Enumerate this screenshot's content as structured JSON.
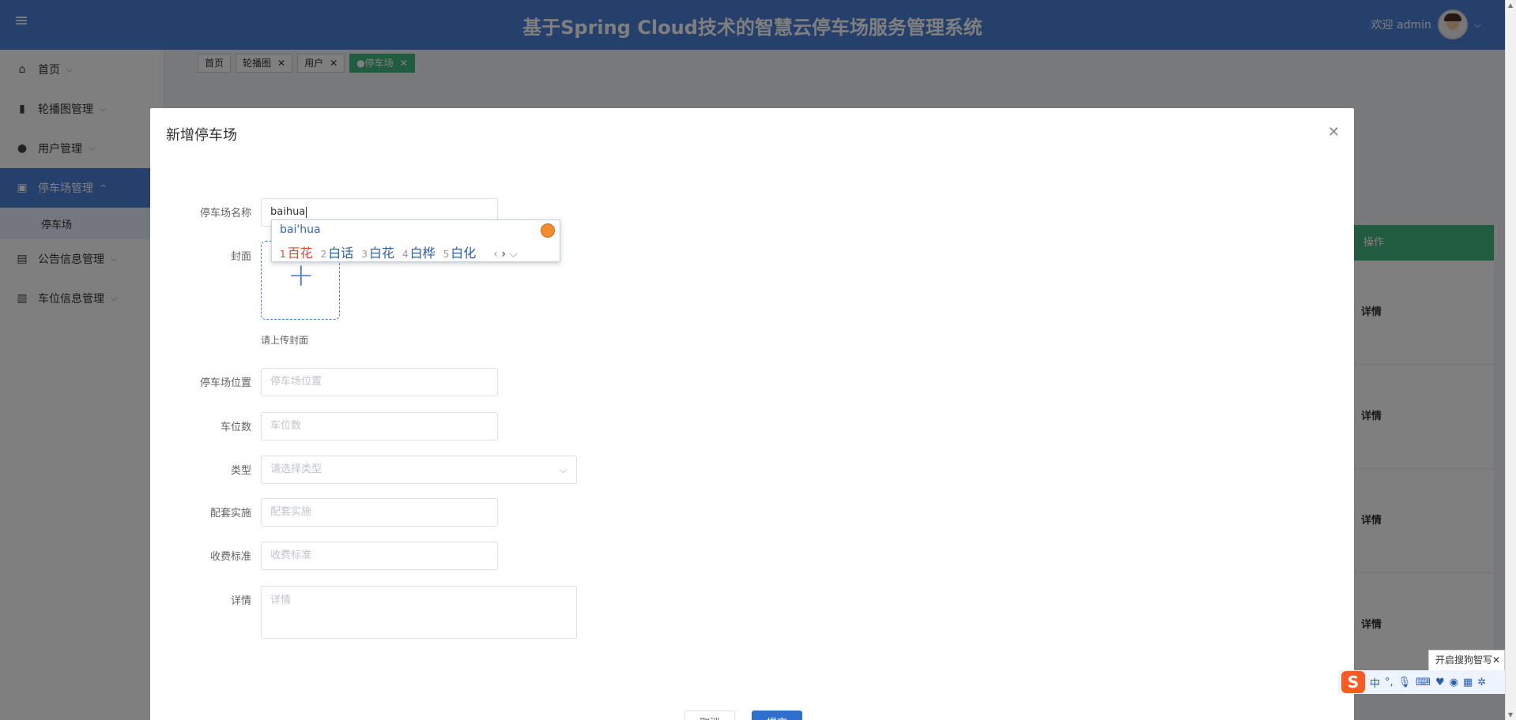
{
  "header": {
    "title": "基于Spring Cloud技术的智慧云停车场服务管理系统",
    "welcome": "欢迎 admin"
  },
  "sidebar": {
    "items": [
      {
        "label": "首页",
        "icon": "home-icon"
      },
      {
        "label": "轮播图管理",
        "icon": "book-icon"
      },
      {
        "label": "用户管理",
        "icon": "user-icon"
      },
      {
        "label": "停车场管理",
        "icon": "gift-icon"
      },
      {
        "sub": "停车场"
      },
      {
        "label": "公告信息管理",
        "icon": "briefcase-icon"
      },
      {
        "label": "车位信息管理",
        "icon": "chart-icon"
      }
    ]
  },
  "tabs": [
    {
      "label": "首页"
    },
    {
      "label": "轮播图"
    },
    {
      "label": "用户"
    },
    {
      "label": "●停车场"
    }
  ],
  "background_table": {
    "header": "操作",
    "rows": [
      "详情",
      "详情",
      "详情",
      "详情"
    ]
  },
  "dialog": {
    "title": "新增停车场",
    "fields": {
      "name_label": "停车场名称",
      "name_value": "baihua",
      "cover_label": "封面",
      "cover_tip": "请上传封面",
      "location_label": "停车场位置",
      "location_placeholder": "停车场位置",
      "spaces_label": "车位数",
      "spaces_placeholder": "车位数",
      "type_label": "类型",
      "type_placeholder": "请选择类型",
      "facilities_label": "配套实施",
      "facilities_placeholder": "配套实施",
      "fee_label": "收费标准",
      "fee_placeholder": "收费标准",
      "detail_label": "详情",
      "detail_placeholder": "详情"
    },
    "buttons": {
      "cancel": "取消",
      "submit": "提交"
    }
  },
  "ime": {
    "pinyin": "bai'hua",
    "candidates": [
      {
        "n": "1",
        "text": "百花"
      },
      {
        "n": "2",
        "text": "白话"
      },
      {
        "n": "3",
        "text": "白花"
      },
      {
        "n": "4",
        "text": "白桦"
      },
      {
        "n": "5",
        "text": "白化"
      }
    ],
    "zhixie": "开启搜狗智写",
    "toolbar": {
      "lang": "中",
      "punct": "°,"
    }
  }
}
